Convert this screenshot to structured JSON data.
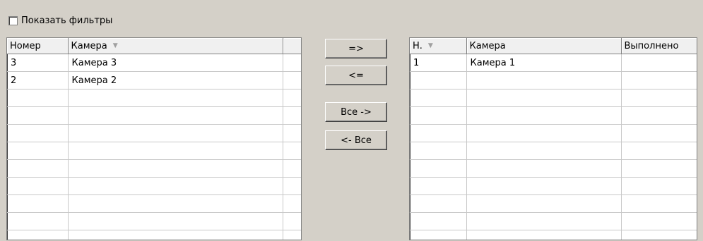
{
  "filters": {
    "show_filters_label": "Показать фильтры",
    "checked": false
  },
  "left_grid": {
    "columns": [
      "Номер",
      "Камера"
    ],
    "sorted_column": "Камера",
    "rows": [
      {
        "number": "3",
        "camera": "Камера 3"
      },
      {
        "number": "2",
        "camera": "Камера 2"
      }
    ]
  },
  "buttons": {
    "move_right": "=>",
    "move_left": "<=",
    "all_right": "Все ->",
    "all_left": "<- Все"
  },
  "right_grid": {
    "columns": [
      "Н.",
      "Камера",
      "Выполнено"
    ],
    "sorted_column": "Н.",
    "rows": [
      {
        "number": "1",
        "camera": "Камера 1",
        "done": ""
      }
    ]
  }
}
